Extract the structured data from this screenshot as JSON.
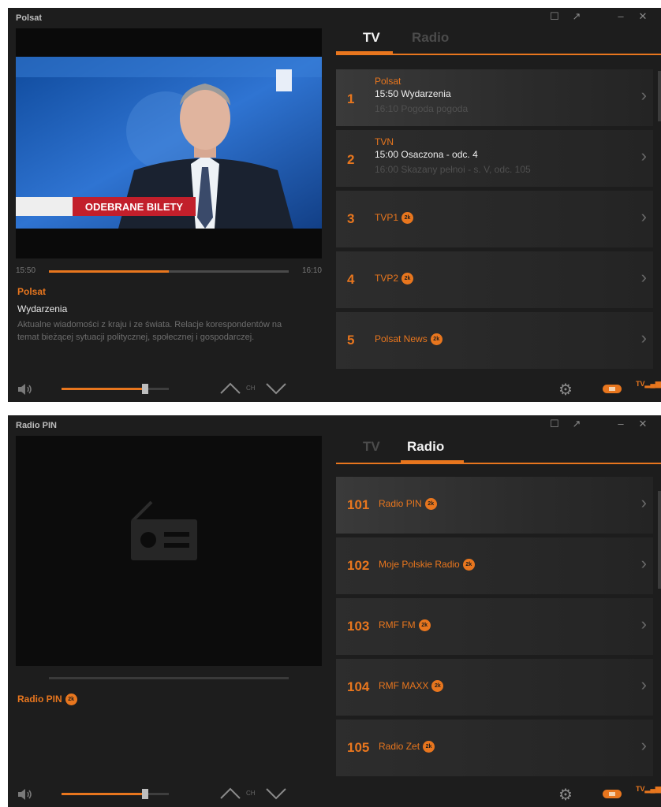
{
  "windows": [
    {
      "title": "Polsat",
      "controls": {
        "restore": "☐",
        "popout": "↗",
        "minimize": "–",
        "close": "✕"
      },
      "tabs": {
        "tv": "TV",
        "radio": "Radio",
        "active": "tv"
      },
      "video": {
        "ticker": "ODEBRANE BILETY"
      },
      "progress": {
        "start": "15:50",
        "end": "16:10",
        "fraction": 0.5
      },
      "now": {
        "channel": "Polsat",
        "program": "Wydarzenia",
        "description": "Aktualne wiadomości z kraju i ze świata. Relacje korespondentów na temat bieżącej sytuacji politycznej, społecznej i gospodarczej."
      },
      "channels": [
        {
          "num": "1",
          "name": "Polsat",
          "hd": "",
          "line1": "15:50  Wydarzenia",
          "line2": "16:10  Pogoda pogoda"
        },
        {
          "num": "2",
          "name": "TVN",
          "hd": "",
          "line1": "15:00  Osaczona - odc. 4",
          "line2": "16:00  Skazany pełnoi - s. V, odc. 105"
        },
        {
          "num": "3",
          "name": "TVP1",
          "hd": "2k",
          "line1": "",
          "line2": ""
        },
        {
          "num": "4",
          "name": "TVP2",
          "hd": "2k",
          "line1": "",
          "line2": ""
        },
        {
          "num": "5",
          "name": "Polsat News",
          "hd": "2k",
          "line1": "",
          "line2": ""
        }
      ],
      "volume": 0.78,
      "ch_label": "CH",
      "tvbadge": "TV"
    },
    {
      "title": "Radio PIN",
      "controls": {
        "restore": "☐",
        "popout": "↗",
        "minimize": "–",
        "close": "✕"
      },
      "tabs": {
        "tv": "TV",
        "radio": "Radio",
        "active": "radio"
      },
      "now": {
        "channel": "Radio PIN",
        "hd": "2k"
      },
      "channels": [
        {
          "num": "101",
          "name": "Radio PIN",
          "hd": "2k"
        },
        {
          "num": "102",
          "name": "Moje Polskie Radio",
          "hd": "2k"
        },
        {
          "num": "103",
          "name": "RMF FM",
          "hd": "2k"
        },
        {
          "num": "104",
          "name": "RMF MAXX",
          "hd": "2k"
        },
        {
          "num": "105",
          "name": "Radio Zet",
          "hd": "2k"
        }
      ],
      "volume": 0.78,
      "ch_label": "CH",
      "tvbadge": "TV"
    }
  ],
  "colors": {
    "accent": "#e8761e",
    "panel": "#1d1d1d",
    "row": "#2b2b2b"
  }
}
